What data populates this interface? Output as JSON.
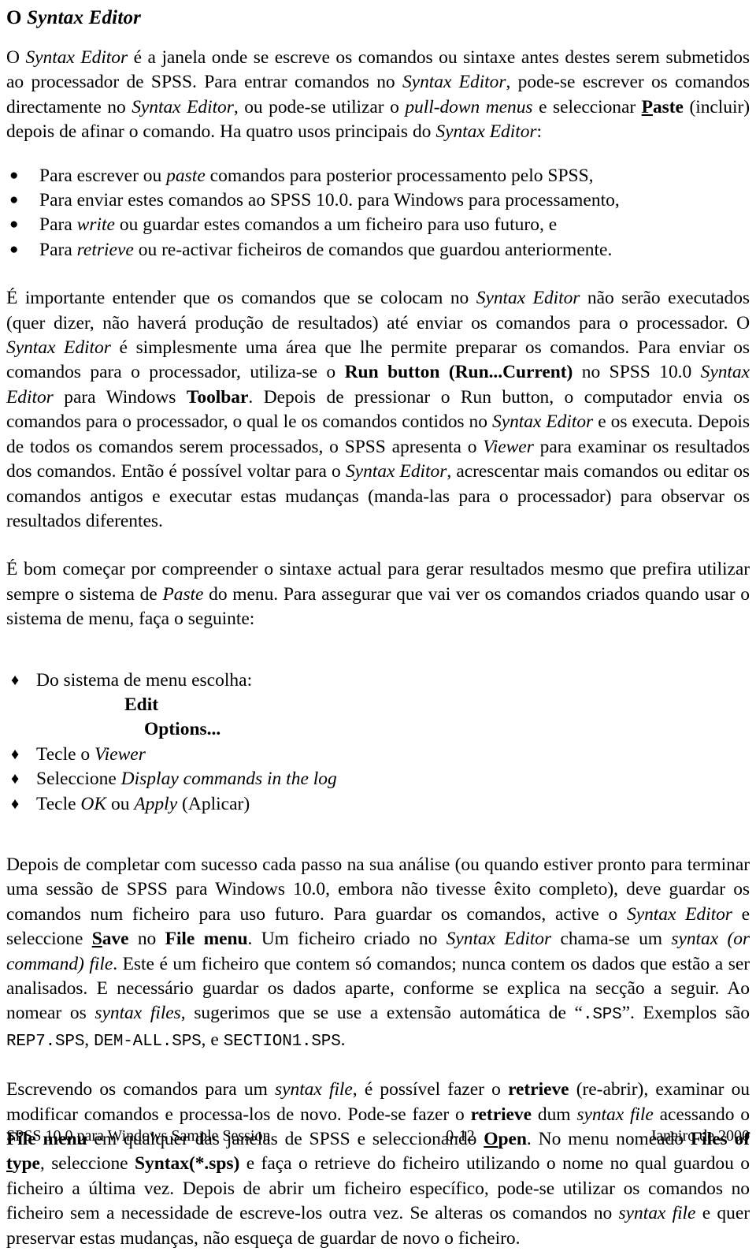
{
  "document": {
    "heading_prefix": "O ",
    "heading_title": "Syntax Editor"
  },
  "paragraphs": {
    "intro": {
      "seg1": "O ",
      "seg2_italic": "Syntax Editor",
      "seg3": " é a janela onde se escreve os comandos ou sintaxe antes destes serem submetidos ao processador de SPSS.  Para entrar comandos no ",
      "seg4_italic": "Syntax Editor",
      "seg5": ", pode-se escrever os comandos directamente no ",
      "seg6_italic": "Syntax Editor",
      "seg7": ", ou pode-se utilizar o ",
      "seg8_italic": "pull-down menus",
      "seg9": " e seleccionar ",
      "seg10_bold_accel": "P",
      "seg11_bold": "aste",
      "seg12": " (incluir) depois de afinar o comando.  Ha quatro usos principais do ",
      "seg13_italic": "Syntax Editor",
      "seg14": ":"
    },
    "exec": {
      "seg1": "É importante entender que os comandos que se colocam no ",
      "seg2_italic": "Syntax Editor",
      "seg3": " não serão executados (quer dizer, não haverá produção de resultados) até enviar os comandos para o processador.  O ",
      "seg4_italic": "Syntax Editor",
      "seg5": " é simplesmente uma área que lhe permite preparar os comandos.  Para enviar os comandos para o processador, utiliza-se o ",
      "seg6_bold": "Run button (Run...Current)",
      "seg7": " no SPSS 10.0 ",
      "seg8_italic": "Syntax Editor",
      "seg9": " para Windows ",
      "seg10_bold": "Toolbar",
      "seg11": ".  Depois de pressionar o Run button, o computador envia os comandos para o processador, o qual le os comandos contidos no ",
      "seg12_italic": "Syntax Editor",
      "seg13": " e os executa.  Depois de todos os comandos serem processados, o SPSS apresenta o ",
      "seg14_italic": "Viewer",
      "seg15": " para examinar os resultados dos comandos.  Então é possível voltar para o ",
      "seg16_italic": "Syntax Editor",
      "seg17": ", acrescentar mais comandos ou editar os comandos antigos e executar estas mudanças (manda-las para o processador) para observar os resultados diferentes."
    },
    "begin": {
      "seg1": "É bom começar por compreender o sintaxe actual para gerar resultados mesmo que prefira utilizar sempre o sistema de ",
      "seg2_italic": "Paste",
      "seg3": " do menu.  Para assegurar que vai ver os comandos criados quando usar o sistema de menu, faça o seguinte:"
    },
    "save": {
      "seg1": "Depois de completar com sucesso cada passo na sua análise (ou quando estiver pronto para terminar uma sessão de SPSS para Windows 10.0, embora não tivesse êxito completo), deve guardar os comandos num ficheiro para uso futuro.  Para guardar os comandos, active o ",
      "seg2_italic": "Syntax Editor",
      "seg3": " e seleccione ",
      "seg4_bold_accel": "S",
      "seg5_bold": "ave",
      "seg6": " no ",
      "seg7_bold": "File menu",
      "seg8": ".  Um ficheiro criado no ",
      "seg9_italic": "Syntax Editor",
      "seg10": " chama-se um ",
      "seg11_italic": "syntax (or command) file",
      "seg12": ".  Este é um ficheiro que contem só comandos; nunca contem os dados que estão a ser analisados.  E necessário guardar os dados aparte, conforme se explica na secção a seguir.  Ao nomear os ",
      "seg13_italic": "syntax files",
      "seg14": ", sugerimos que se use a extensão automática de “",
      "seg15_mono": ".SPS",
      "seg16": "”.  Exemplos são ",
      "seg17_mono": "REP7.SPS",
      "seg18": ", ",
      "seg19_mono": "DEM-ALL.SPS",
      "seg20": ", e ",
      "seg21_mono": "SECTION1.SPS",
      "seg22": "."
    },
    "retrieve": {
      "seg1": "Escrevendo os comandos para um ",
      "seg2_italic": "syntax file",
      "seg3": ", é possível fazer o ",
      "seg4_bold": "retrieve",
      "seg5": " (re-abrir), examinar ou modificar comandos e processa-los de novo.  Pode-se fazer o ",
      "seg6_bold": "retrieve",
      "seg7": " dum ",
      "seg8_italic": "syntax file",
      "seg9": " acessando o ",
      "seg10_bold": "File menu",
      "seg11": " em qualquer das janelas de SPSS e seleccionando ",
      "seg12_bold_accel": "O",
      "seg13_bold": "pen",
      "seg14": ".  No menu nomeado ",
      "seg15_bold": "Files of ",
      "seg16_bold_accel": "t",
      "seg17_bold": "ype",
      "seg18": ", seleccione ",
      "seg19_bold": "Syntax(*.sps)",
      "seg20": " e faça o retrieve do ficheiro utilizando o nome no qual guardou o ficheiro a última vez.  Depois de abrir um ficheiro específico, pode-se utilizar os comandos no ficheiro sem a necessidade de escreve-los outra vez.  Se alteras os comandos no ",
      "seg21_italic": "syntax file",
      "seg22": " e quer preservar estas mudanças, não esqueça de guardar de novo o ficheiro."
    }
  },
  "uses_list": {
    "glyph": "●",
    "items": [
      {
        "pre": "Para escrever ou ",
        "em": "paste",
        "post": " comandos para posterior processamento pelo SPSS,"
      },
      {
        "pre": "Para enviar estes comandos ao SPSS 10.0. para Windows para processamento,",
        "em": "",
        "post": ""
      },
      {
        "pre": "Para ",
        "em": "write",
        "post": " ou guardar estes comandos a um ficheiro para uso futuro, e"
      },
      {
        "pre": "Para ",
        "em": "retrieve",
        "post": " ou re-activar ficheiros de comandos que guardou anteriormente."
      }
    ]
  },
  "steps_list": {
    "glyph": "♦",
    "item1": {
      "pre": "Do sistema de menu escolha:",
      "em": "",
      "post": ""
    },
    "menu_level1": "Edit",
    "menu_level2": "Options...",
    "item2": {
      "pre": "Tecle o ",
      "em": "Viewer",
      "post": ""
    },
    "item3": {
      "pre": "Seleccione ",
      "em": "Display commands in the log",
      "post": ""
    },
    "item4": {
      "pre": "Tecle ",
      "em": "OK",
      "mid": " ou ",
      "em2": "Apply",
      "post": " (Aplicar)"
    }
  },
  "footer": {
    "left": "SPSS 10.0 para Windows Sample Session",
    "center": "0-12",
    "right": "Janeiro de 2000"
  }
}
